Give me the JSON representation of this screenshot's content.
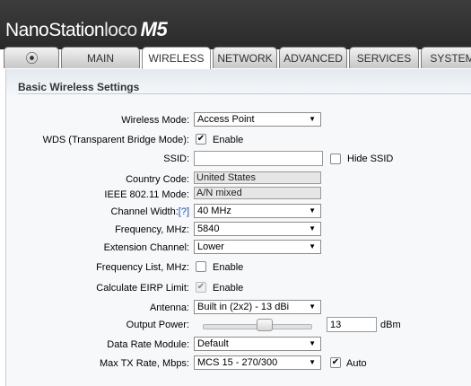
{
  "header": {
    "brand_name": "NanoStation",
    "brand_suffix": "loco",
    "brand_model": "M5"
  },
  "tabs": [
    {
      "label": "⦿",
      "active": false
    },
    {
      "label": "MAIN",
      "active": false
    },
    {
      "label": "WIRELESS",
      "active": true
    },
    {
      "label": "NETWORK",
      "active": false
    },
    {
      "label": "ADVANCED",
      "active": false
    },
    {
      "label": "SERVICES",
      "active": false
    },
    {
      "label": "SYSTEM",
      "active": false
    }
  ],
  "section_title": "Basic Wireless Settings",
  "form": {
    "wireless_mode": {
      "label": "Wireless Mode:",
      "value": "Access Point"
    },
    "wds": {
      "label": "WDS (Transparent Bridge Mode):",
      "checked": true,
      "option": "Enable"
    },
    "ssid": {
      "label": "SSID:",
      "value": "",
      "hide_label": "Hide SSID",
      "hide_checked": false
    },
    "country_code": {
      "label": "Country Code:",
      "value": "United States"
    },
    "ieee_mode": {
      "label": "IEEE 802.11 Mode:",
      "value": "A/N mixed"
    },
    "channel_width": {
      "label": "Channel Width:",
      "help": "[?]",
      "value": "40 MHz"
    },
    "frequency": {
      "label": "Frequency, MHz:",
      "value": "5840"
    },
    "extension_channel": {
      "label": "Extension Channel:",
      "value": "Lower"
    },
    "frequency_list": {
      "label": "Frequency List, MHz:",
      "checked": false,
      "option": "Enable"
    },
    "eirp": {
      "label": "Calculate EIRP Limit:",
      "checked": true,
      "option": "Enable"
    },
    "antenna": {
      "label": "Antenna:",
      "value": "Built in (2x2) - 13 dBi"
    },
    "output_power": {
      "label": "Output Power:",
      "value": "13",
      "unit": "dBm",
      "level": 0.5
    },
    "data_rate_module": {
      "label": "Data Rate Module:",
      "value": "Default"
    },
    "max_tx_rate": {
      "label": "Max TX Rate, Mbps:",
      "value": "MCS 15 - 270/300",
      "auto_label": "Auto",
      "auto_checked": true
    }
  }
}
